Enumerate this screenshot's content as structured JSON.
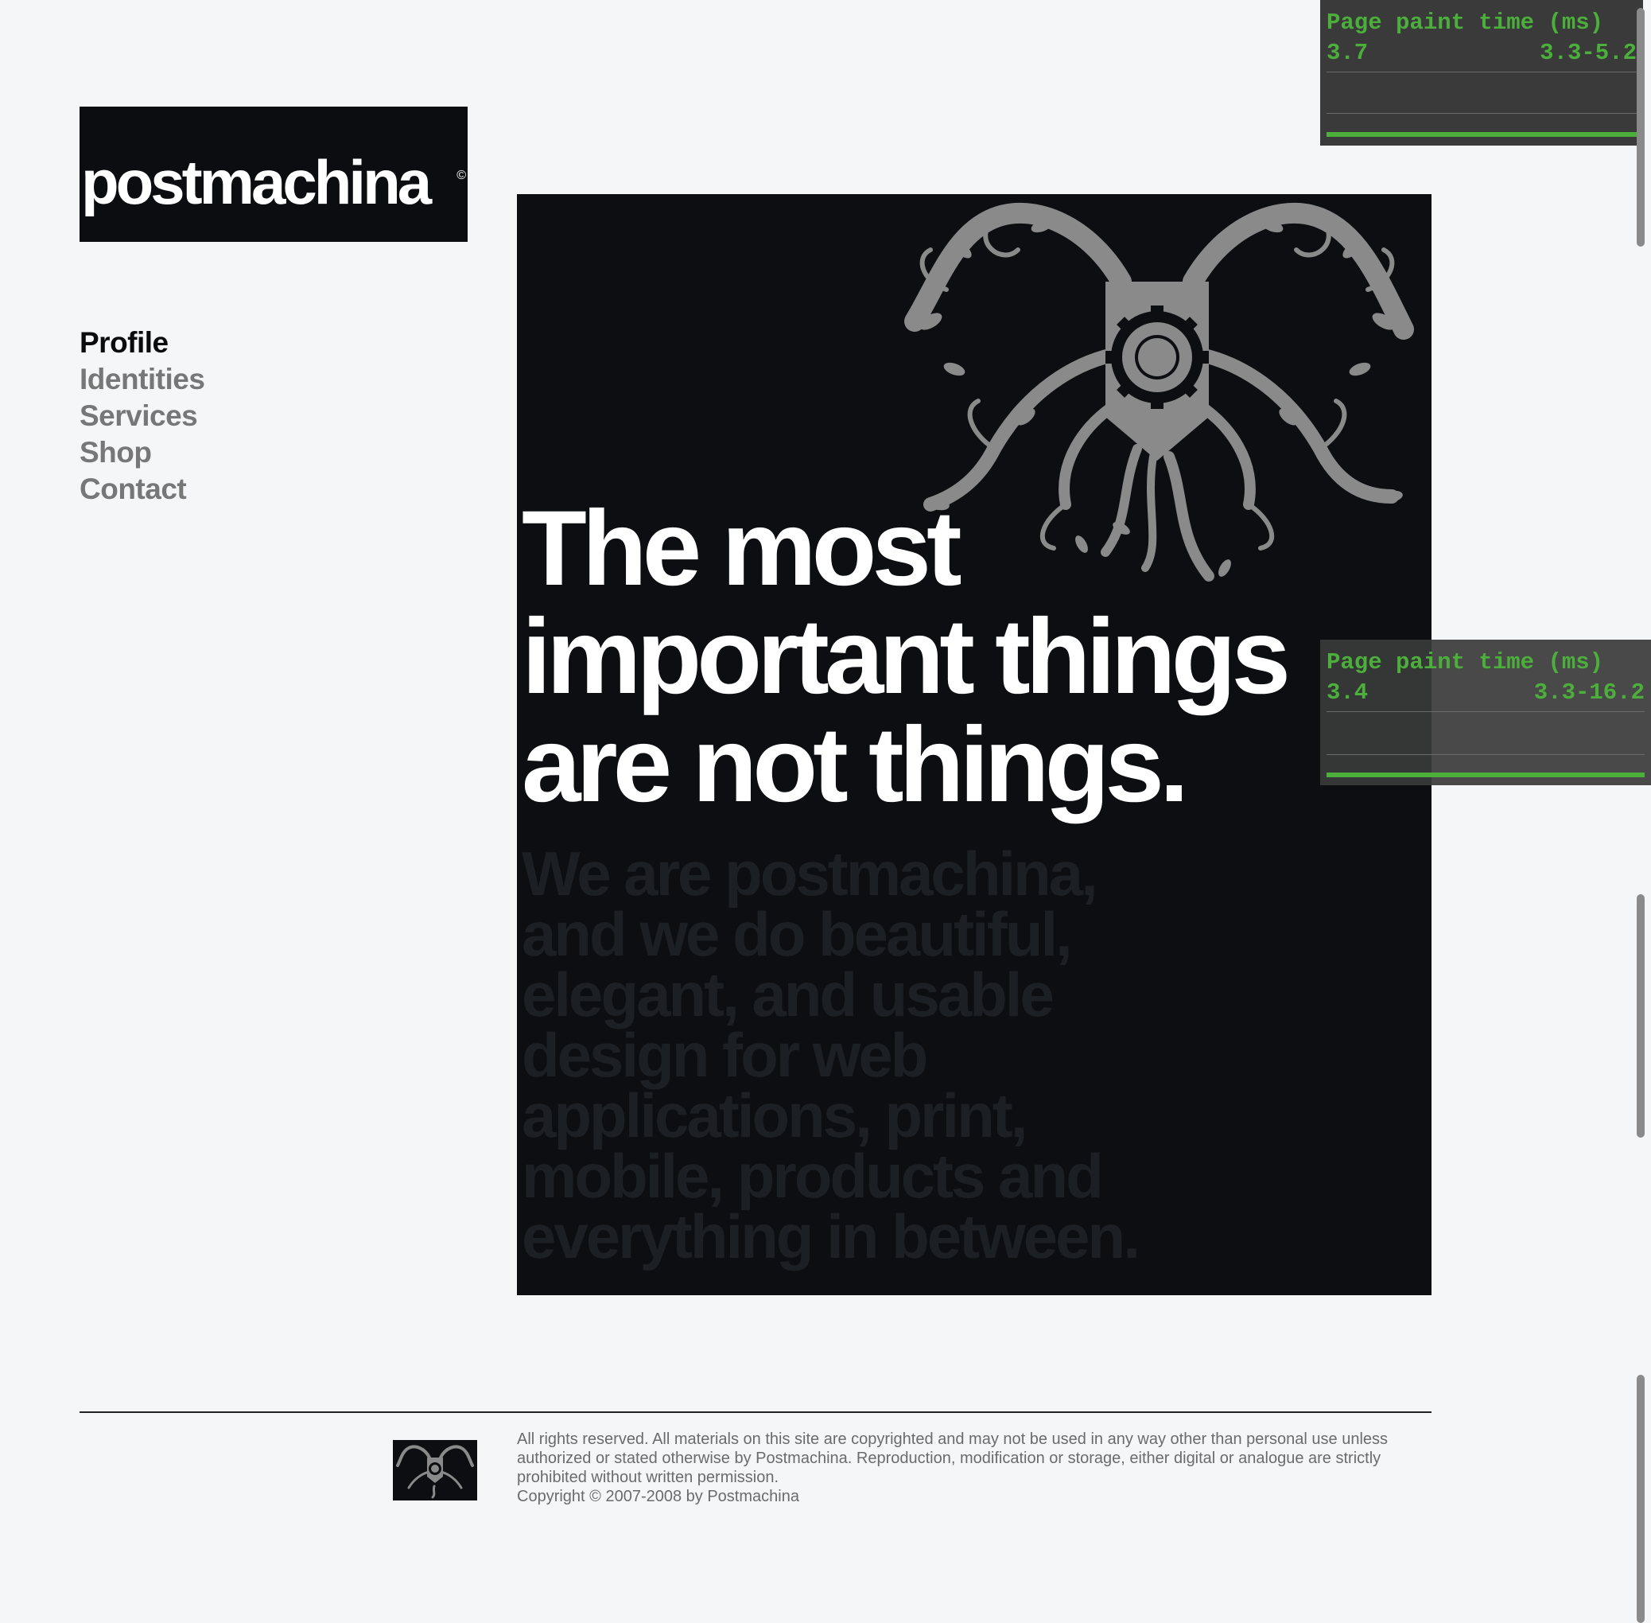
{
  "brand": {
    "name": "postmachina",
    "mark": "©"
  },
  "nav": {
    "items": [
      {
        "label": "Profile",
        "active": true
      },
      {
        "label": "Identities",
        "active": false
      },
      {
        "label": "Services",
        "active": false
      },
      {
        "label": "Shop",
        "active": false
      },
      {
        "label": "Contact",
        "active": false
      }
    ]
  },
  "hero": {
    "headline": [
      "The most",
      "important things",
      "are not things."
    ],
    "subcopy": [
      "We are postmachina,",
      "and we do beautiful,",
      "elegant, and usable",
      "design for web",
      "applications, print,",
      "mobile, products and",
      "everything in between."
    ]
  },
  "perf_overlays": [
    {
      "title": "Page paint time (ms)",
      "value": "3.7",
      "range": "3.3-5.2"
    },
    {
      "title": "Page paint time (ms)",
      "value": "3.4",
      "range": "3.3-16.2"
    }
  ],
  "footer": {
    "legal": "All rights reserved. All materials on this site are copyrighted and may not be used in any way other than personal use unless authorized or stated otherwise by Postmachina. Reproduction, modification or storage, either digital or analogue are strictly prohibited without written permission.",
    "copyright": "Copyright © 2007-2008 by Postmachina"
  },
  "colors": {
    "page_bg": "#f5f6f8",
    "poster_bg": "#0c0e11",
    "nav_active": "#0b0b0b",
    "nav_inactive": "#777777",
    "emblem_gray": "#8a8a8a",
    "subcopy": "#1c1f24",
    "perf_green": "#4caf3c"
  }
}
